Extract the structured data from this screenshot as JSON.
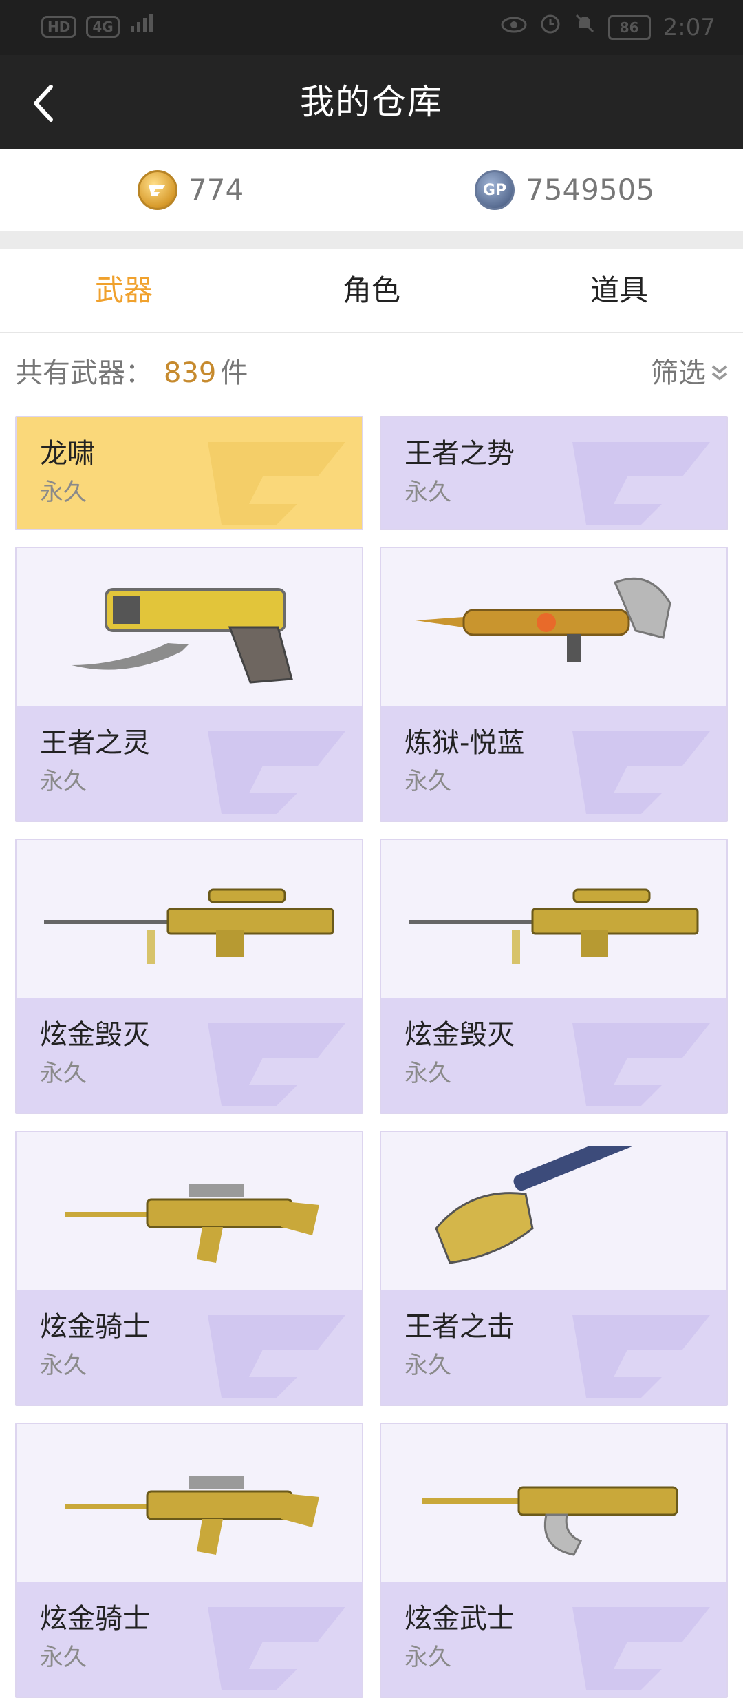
{
  "status_bar": {
    "time": "2:07",
    "battery": "86",
    "left_chips": [
      "HD",
      "4G"
    ]
  },
  "header": {
    "title": "我的仓库",
    "back_icon": "chevron-left-icon"
  },
  "currency": {
    "cf_points": "774",
    "gp_points": "7549505",
    "gp_badge": "GP"
  },
  "tabs": [
    {
      "label": "武器",
      "active": true
    },
    {
      "label": "角色",
      "active": false
    },
    {
      "label": "道具",
      "active": false
    }
  ],
  "summary": {
    "label": "共有武器：",
    "count": "839",
    "unit": "件",
    "filter_label": "筛选"
  },
  "items": [
    {
      "name": "龙啸",
      "duration": "永久"
    },
    {
      "name": "王者之势",
      "duration": "永久"
    },
    {
      "name": "王者之灵",
      "duration": "永久"
    },
    {
      "name": "炼狱-悦蓝",
      "duration": "永久"
    },
    {
      "name": "炫金毁灭",
      "duration": "永久"
    },
    {
      "name": "炫金毁灭",
      "duration": "永久"
    },
    {
      "name": "炫金骑士",
      "duration": "永久"
    },
    {
      "name": "王者之击",
      "duration": "永久"
    },
    {
      "name": "炫金骑士",
      "duration": "永久"
    },
    {
      "name": "炫金武士",
      "duration": "永久"
    }
  ],
  "colors": {
    "nav_bg": "#242424",
    "accent": "#f0a12d",
    "card_lavender": "#ddd5f4",
    "card_gold": "#fad87a"
  }
}
